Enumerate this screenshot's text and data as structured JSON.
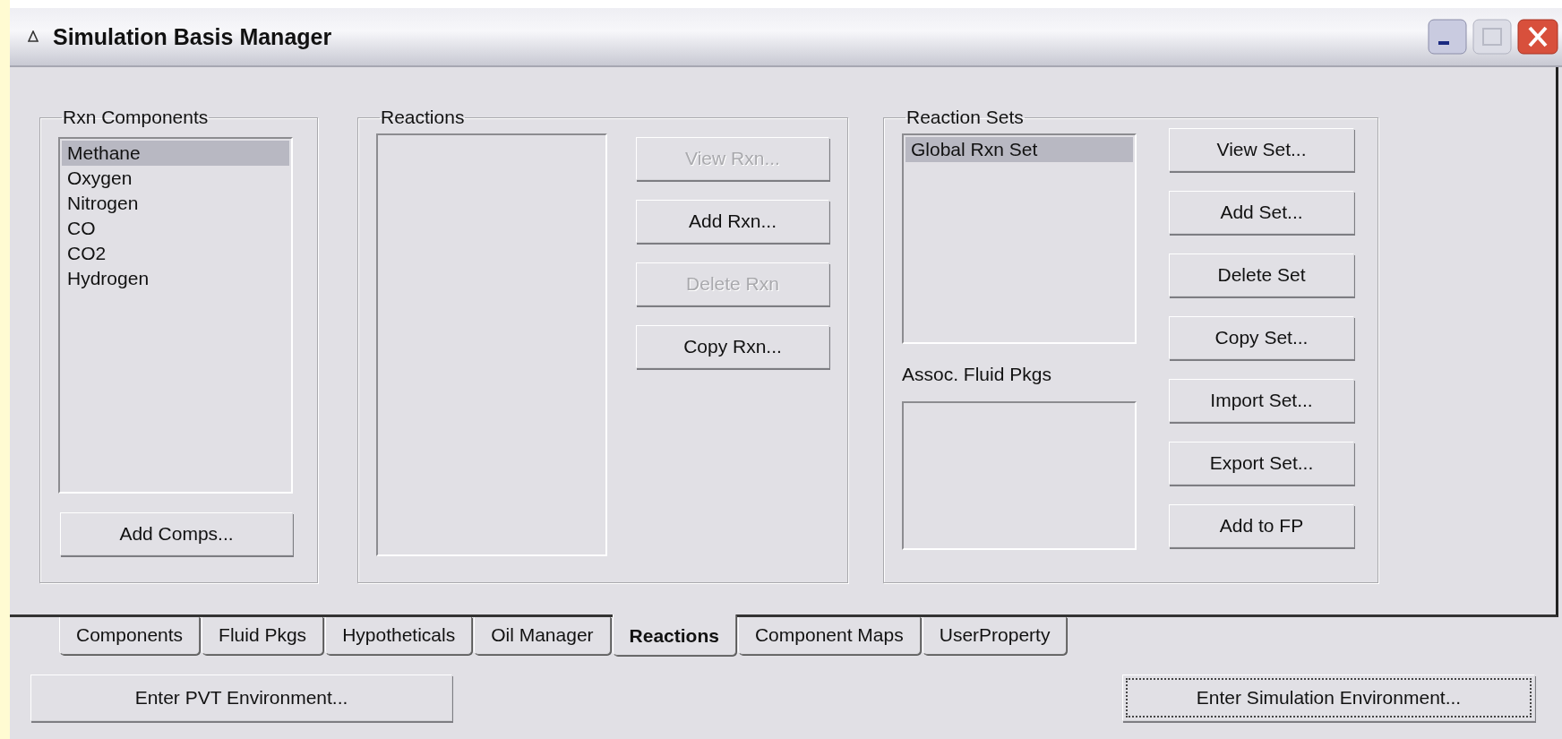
{
  "window": {
    "title": "Simulation Basis Manager"
  },
  "rxn_components": {
    "label": "Rxn Components",
    "items": [
      {
        "label": "Methane",
        "selected": true
      },
      {
        "label": "Oxygen",
        "selected": false
      },
      {
        "label": "Nitrogen",
        "selected": false
      },
      {
        "label": "CO",
        "selected": false
      },
      {
        "label": "CO2",
        "selected": false
      },
      {
        "label": "Hydrogen",
        "selected": false
      }
    ],
    "button": {
      "label": "Add Comps...",
      "disabled": false
    }
  },
  "reactions": {
    "label": "Reactions",
    "buttons": [
      {
        "label": "View Rxn...",
        "disabled": true
      },
      {
        "label": "Add Rxn...",
        "disabled": false
      },
      {
        "label": "Delete Rxn",
        "disabled": true
      },
      {
        "label": "Copy Rxn...",
        "disabled": false
      }
    ]
  },
  "reaction_sets": {
    "label": "Reaction Sets",
    "items": [
      {
        "label": "Global Rxn Set",
        "selected": true
      }
    ],
    "assoc_label": "Assoc. Fluid Pkgs",
    "buttons": [
      {
        "label": "View Set...",
        "disabled": false
      },
      {
        "label": "Add Set...",
        "disabled": false
      },
      {
        "label": "Delete Set",
        "disabled": false
      },
      {
        "label": "Copy Set...",
        "disabled": false
      },
      {
        "label": "Import Set...",
        "disabled": false
      },
      {
        "label": "Export Set...",
        "disabled": false
      },
      {
        "label": "Add to FP",
        "disabled": false
      }
    ]
  },
  "tabs": [
    {
      "label": "Components",
      "selected": false
    },
    {
      "label": "Fluid Pkgs",
      "selected": false
    },
    {
      "label": "Hypotheticals",
      "selected": false
    },
    {
      "label": "Oil Manager",
      "selected": false
    },
    {
      "label": "Reactions",
      "selected": true
    },
    {
      "label": "Component Maps",
      "selected": false
    },
    {
      "label": "UserProperty",
      "selected": false
    }
  ],
  "buttons": [
    {
      "label": "Enter PVT Environment...",
      "focused": false
    },
    {
      "label": "Enter Simulation Environment...",
      "focused": true
    }
  ]
}
